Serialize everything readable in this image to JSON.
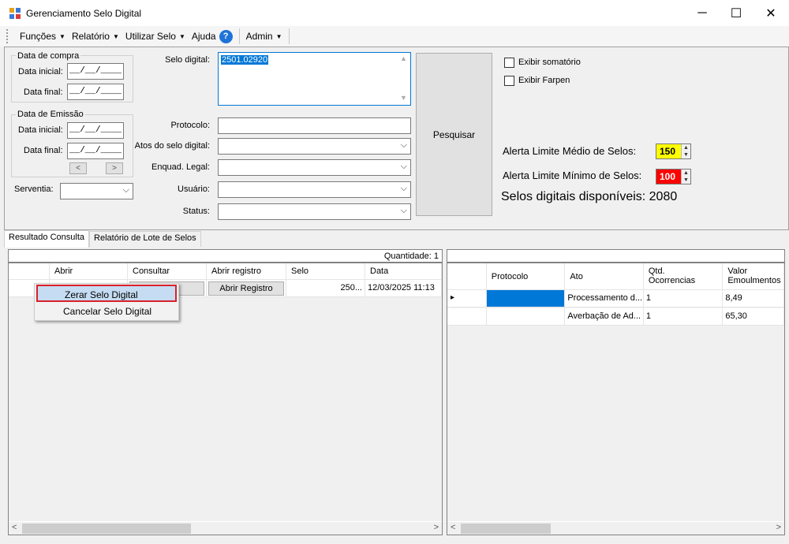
{
  "window": {
    "title": "Gerenciamento Selo Digital",
    "minimize": "─",
    "maximize": "☐",
    "close": "✕"
  },
  "menu": {
    "items": [
      "Funções",
      "Relatório",
      "Utilizar Selo",
      "Ajuda",
      "Admin"
    ],
    "help_icon": "?"
  },
  "filters": {
    "data_compra_label": "Data de compra",
    "data_emissao_label": "Data de Emissão",
    "data_inicial_label": "Data inicial:",
    "data_final_label": "Data final:",
    "date_mask": "__/__/____",
    "prev": "<",
    "next": ">",
    "serventia_label": "Serventia:",
    "selo_digital_label": "Selo digital:",
    "selo_digital_value": "2501.02920",
    "protocolo_label": "Protocolo:",
    "atos_label": "Atos do selo digital:",
    "enquad_label": "Enquad. Legal:",
    "usuario_label": "Usuário:",
    "status_label": "Status:",
    "pesquisar": "Pesquisar",
    "exibir_somatorio": "Exibir somatório",
    "exibir_farpen": "Exibir Farpen",
    "alerta_medio_label": "Alerta Limite Médio de Selos:",
    "alerta_medio_value": "150",
    "alerta_minimo_label": "Alerta Limite Mínimo de Selos:",
    "alerta_minimo_value": "100",
    "disponiveis": "Selos digitais disponíveis: 2080"
  },
  "colors": {
    "yellow": "#ffff00",
    "red": "#ff0000",
    "selection": "#0078d7"
  },
  "tabs": [
    "Resultado Consulta",
    "Relatório de Lote de Selos"
  ],
  "left_grid": {
    "quantidade": "Quantidade: 1",
    "columns": [
      "",
      "Abrir",
      "Consultar",
      "Abrir registro",
      "Selo",
      "Data"
    ],
    "row": {
      "consultar": "ar",
      "abrir_registro": "Abrir Registro",
      "selo": "250...",
      "data": "12/03/2025 11:13"
    }
  },
  "right_grid": {
    "columns": [
      "",
      "Protocolo",
      "Ato",
      "Qtd.\nOcorrencias",
      "Valor\nEmoulmentos"
    ],
    "rows": [
      {
        "indicator": "▸",
        "protocolo": "",
        "ato": "Processamento d...",
        "qtd": "1",
        "valor": "8,49"
      },
      {
        "indicator": "",
        "protocolo": "",
        "ato": "Averbação de Ad...",
        "qtd": "1",
        "valor": "65,30"
      }
    ]
  },
  "context_menu": {
    "items": [
      "Zerar Selo Digital",
      "Cancelar Selo Digital"
    ]
  }
}
